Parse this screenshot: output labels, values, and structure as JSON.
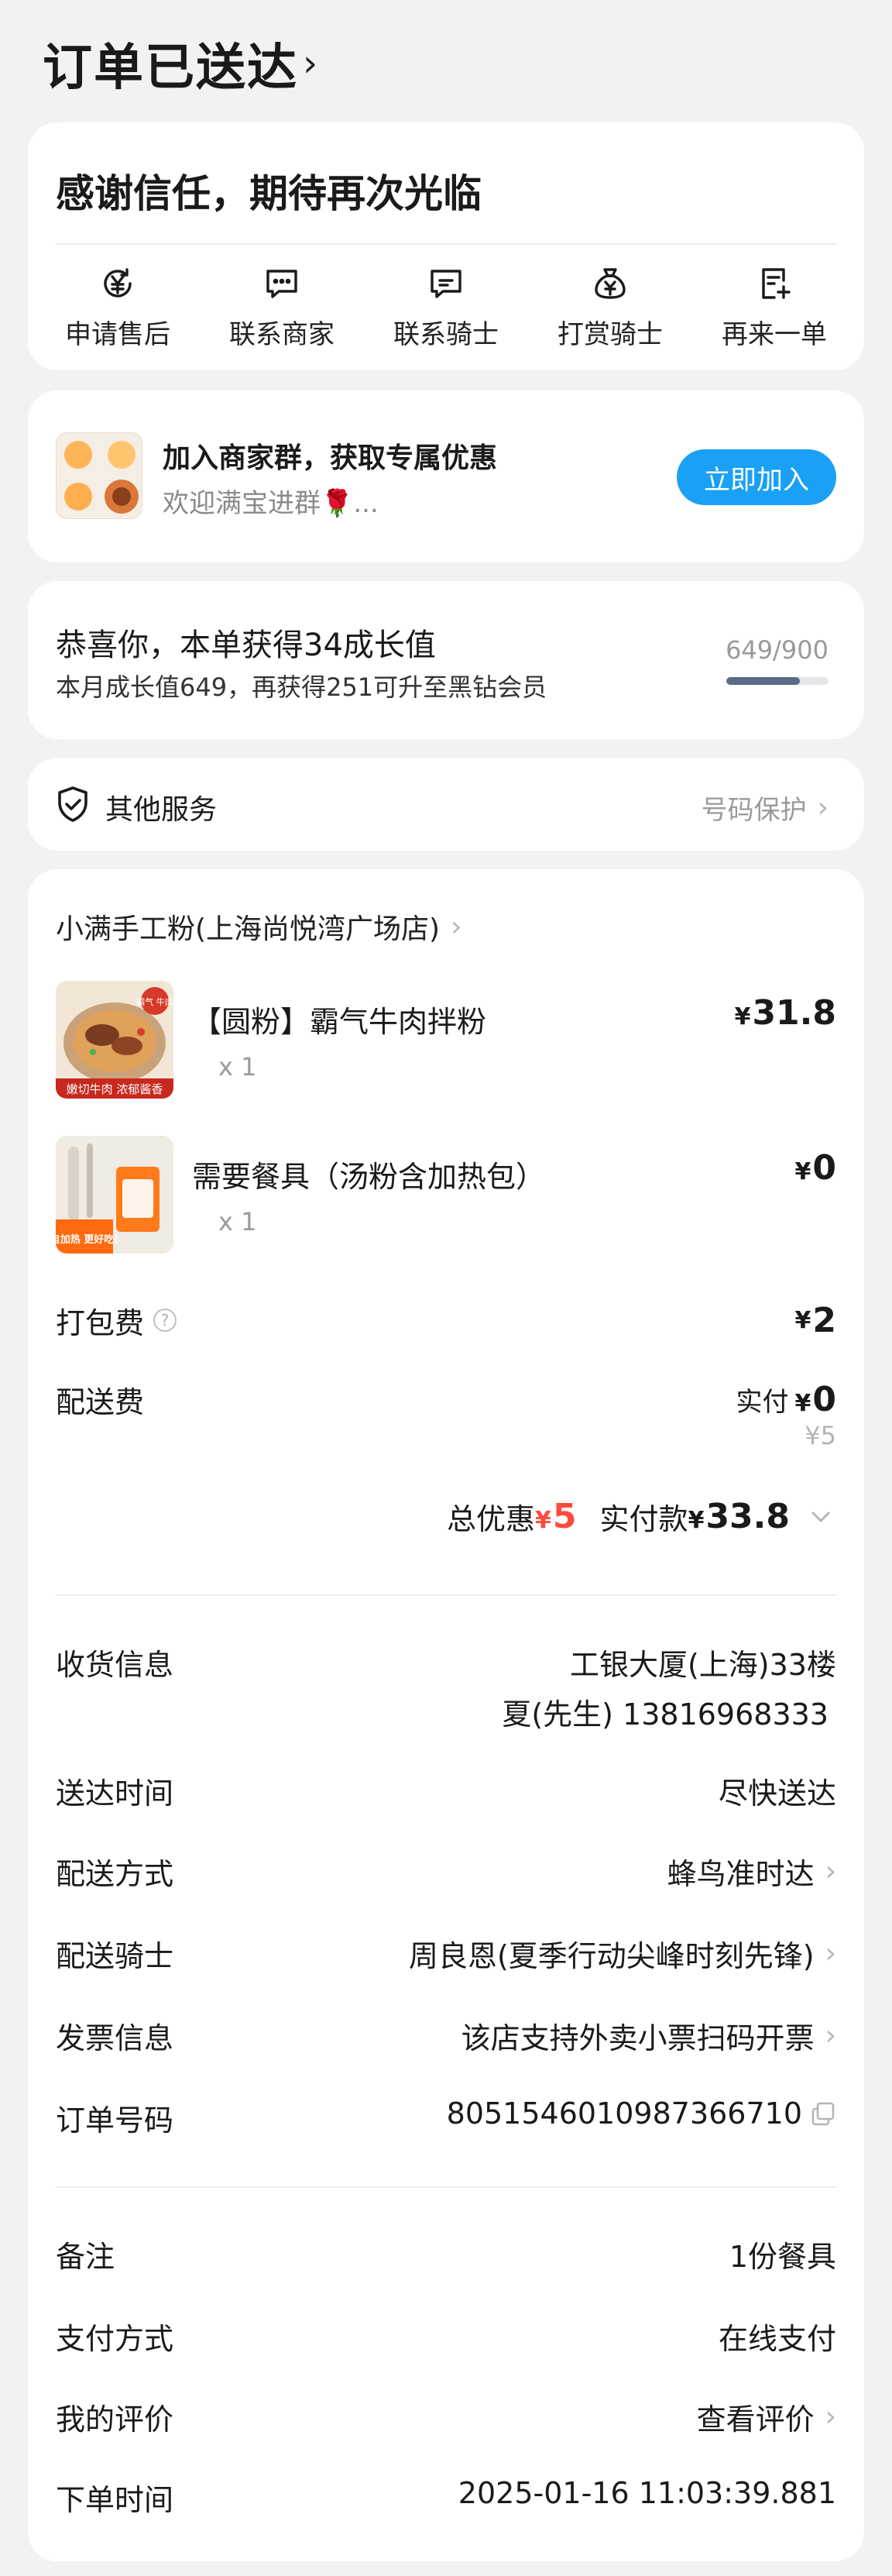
{
  "header": {
    "title": "订单已送达",
    "chevron": "›"
  },
  "thanks_card": {
    "message": "感谢信任，期待再次光临",
    "actions": [
      {
        "label": "申请售后",
        "icon": "yen-refresh-icon"
      },
      {
        "label": "联系商家",
        "icon": "chat-icon"
      },
      {
        "label": "联系骑士",
        "icon": "chat-rider-icon"
      },
      {
        "label": "打赏骑士",
        "icon": "money-bag-icon"
      },
      {
        "label": "再来一单",
        "icon": "reorder-icon"
      }
    ]
  },
  "merchant_group": {
    "title": "加入商家群，获取专属优惠",
    "subtitle": "欢迎满宝进群🌹...",
    "button": "立即加入"
  },
  "growth": {
    "title": "恭喜你，本单获得34成长值",
    "subtitle": "本月成长值649，再获得251可升至黑钻会员",
    "progress_text": "649/900",
    "progress_fraction": 0.721
  },
  "other_services": {
    "title": "其他服务",
    "value": "号码保护"
  },
  "order": {
    "shop_name": "小满手工粉(上海尚悦湾广场店)",
    "items": [
      {
        "name": "【圆粉】霸气牛肉拌粉",
        "qty": "x 1",
        "price": "31.8"
      },
      {
        "name": "需要餐具（汤粉含加热包）",
        "qty": "x 1",
        "price": "0"
      }
    ],
    "item_pic_texts": {
      "beef_tag": "霸气 牛肉",
      "beef_banner": "嫩切牛肉 浓郁酱香",
      "utensil_banner": "自加热 更好吃!"
    },
    "packing_fee_label": "打包费",
    "packing_fee": "2",
    "delivery_fee_label": "配送费",
    "delivery_actual_label": "实付",
    "delivery_fee_actual": "0",
    "delivery_fee_original": "¥5",
    "total_discount_label": "总优惠",
    "total_discount": "5",
    "paid_label": "实付款",
    "paid_amount": "33.8",
    "yen": "¥"
  },
  "delivery_info": {
    "address_label": "收货信息",
    "address_line1": "工银大厦(上海)33楼",
    "address_line2": "夏(先生) 13816968333",
    "time_label": "送达时间",
    "time_value": "尽快送达",
    "method_label": "配送方式",
    "method_value": "蜂鸟准时达",
    "rider_label": "配送骑士",
    "rider_value": "周良恩(夏季行动尖峰时刻先锋)",
    "invoice_label": "发票信息",
    "invoice_value": "该店支持外卖小票扫码开票",
    "order_no_label": "订单号码",
    "order_no_value": "8051546010987366710"
  },
  "misc_info": {
    "remark_label": "备注",
    "remark_value": "1份餐具",
    "payment_label": "支付方式",
    "payment_value": "在线支付",
    "review_label": "我的评价",
    "review_value": "查看评价",
    "order_time_label": "下单时间",
    "order_time_value": "2025-01-16 11:03:39.881"
  },
  "colors": {
    "background": "#f2f2f4",
    "accent_blue": "#1aa0f5",
    "discount_red": "#ff4a3d",
    "progress": "#5a6b85"
  }
}
